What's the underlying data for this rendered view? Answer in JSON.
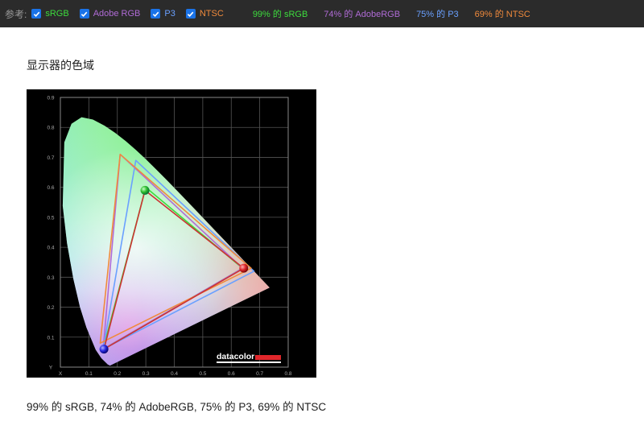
{
  "topbar": {
    "ref_label": "参考:",
    "options": [
      {
        "label": "sRGB",
        "color": "#3ddc3d",
        "checked": true
      },
      {
        "label": "Adobe RGB",
        "color": "#b06bd6",
        "checked": true
      },
      {
        "label": "P3",
        "color": "#6aa0ff",
        "checked": true
      },
      {
        "label": "NTSC",
        "color": "#f08a3c",
        "checked": true
      }
    ],
    "coverage": [
      {
        "text": "99% 的 sRGB",
        "color": "#3ddc3d"
      },
      {
        "text": "74% 的 AdobeRGB",
        "color": "#b06bd6"
      },
      {
        "text": "75% 的 P3",
        "color": "#6aa0ff"
      },
      {
        "text": "69% 的 NTSC",
        "color": "#f08a3c"
      }
    ]
  },
  "content": {
    "heading": "显示器的色域",
    "caption": "99% 的 sRGB, 74% 的 AdobeRGB, 75% 的 P3, 69% 的 NTSC"
  },
  "chart": {
    "brand": "datacolor",
    "x_ticks": [
      "X",
      "0.1",
      "0.2",
      "0.3",
      "0.4",
      "0.5",
      "0.6",
      "0.7",
      "0.8"
    ],
    "y_ticks": [
      "Y",
      "0.1",
      "0.2",
      "0.3",
      "0.4",
      "0.5",
      "0.6",
      "0.7",
      "0.8",
      "0.9"
    ]
  },
  "chart_data": {
    "type": "scatter",
    "x_range": [
      0,
      0.8
    ],
    "y_range": [
      0,
      0.9
    ],
    "grid": true,
    "spectral_locus": [
      [
        0.1741,
        0.005
      ],
      [
        0.1666,
        0.0089
      ],
      [
        0.144,
        0.0297
      ],
      [
        0.1241,
        0.0578
      ],
      [
        0.0913,
        0.1327
      ],
      [
        0.0687,
        0.2007
      ],
      [
        0.0454,
        0.295
      ],
      [
        0.0235,
        0.4127
      ],
      [
        0.0082,
        0.5384
      ],
      [
        0.0139,
        0.7502
      ],
      [
        0.0389,
        0.812
      ],
      [
        0.0743,
        0.8338
      ],
      [
        0.1142,
        0.8262
      ],
      [
        0.1547,
        0.8059
      ],
      [
        0.1929,
        0.7816
      ],
      [
        0.2296,
        0.7543
      ],
      [
        0.2658,
        0.7243
      ],
      [
        0.3016,
        0.6923
      ],
      [
        0.3373,
        0.6589
      ],
      [
        0.3731,
        0.6245
      ],
      [
        0.4087,
        0.5896
      ],
      [
        0.4441,
        0.5547
      ],
      [
        0.4788,
        0.5202
      ],
      [
        0.5125,
        0.4866
      ],
      [
        0.5448,
        0.4544
      ],
      [
        0.5752,
        0.4242
      ],
      [
        0.6029,
        0.3965
      ],
      [
        0.627,
        0.3725
      ],
      [
        0.6482,
        0.3514
      ],
      [
        0.6658,
        0.334
      ],
      [
        0.6801,
        0.3197
      ],
      [
        0.7347,
        0.2653
      ]
    ],
    "series": [
      {
        "name": "sRGB",
        "color": "#3ddc3d",
        "points": [
          [
            0.64,
            0.33
          ],
          [
            0.3,
            0.6
          ],
          [
            0.15,
            0.06
          ]
        ]
      },
      {
        "name": "Adobe RGB",
        "color": "#b06bd6",
        "points": [
          [
            0.64,
            0.33
          ],
          [
            0.21,
            0.71
          ],
          [
            0.15,
            0.06
          ]
        ]
      },
      {
        "name": "P3",
        "color": "#6aa0ff",
        "points": [
          [
            0.68,
            0.32
          ],
          [
            0.265,
            0.69
          ],
          [
            0.15,
            0.06
          ]
        ]
      },
      {
        "name": "NTSC",
        "color": "#f08a3c",
        "points": [
          [
            0.67,
            0.33
          ],
          [
            0.21,
            0.71
          ],
          [
            0.14,
            0.08
          ]
        ]
      },
      {
        "name": "monitor",
        "color": "#cc3333",
        "points": [
          [
            0.644,
            0.33
          ],
          [
            0.297,
            0.59
          ],
          [
            0.153,
            0.06
          ]
        ]
      }
    ],
    "primaries": [
      {
        "label": "red",
        "x": 0.644,
        "y": 0.33,
        "color": "#e0262b"
      },
      {
        "label": "green",
        "x": 0.297,
        "y": 0.59,
        "color": "#2fbf2f"
      },
      {
        "label": "blue",
        "x": 0.153,
        "y": 0.06,
        "color": "#2a2ae0"
      }
    ]
  }
}
